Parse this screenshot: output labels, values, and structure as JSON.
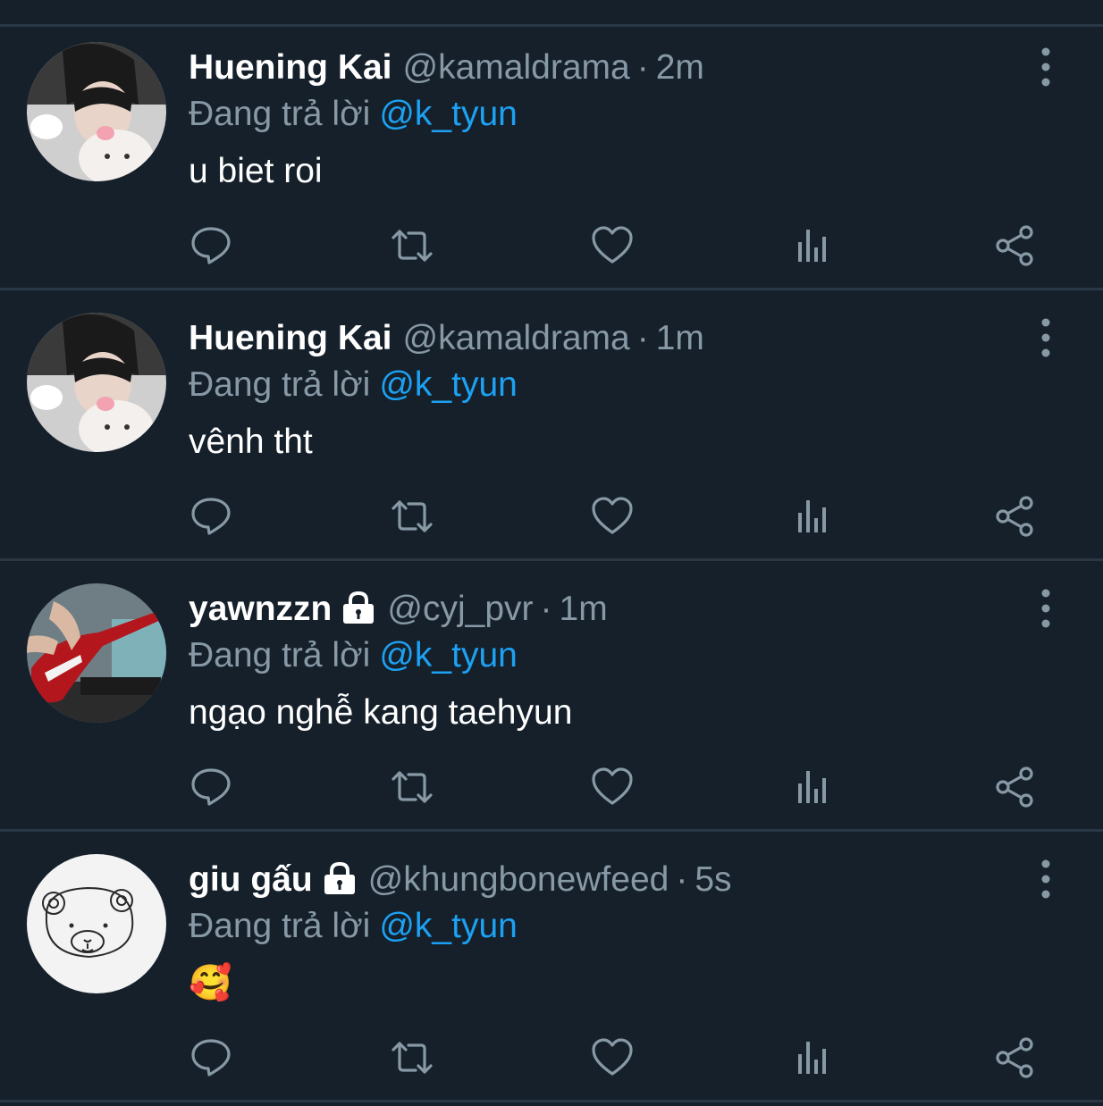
{
  "colors": {
    "background": "#15202b",
    "divider": "#2a3744",
    "secondary_text": "#8899a6",
    "accent": "#1da1f2"
  },
  "tweets": [
    {
      "name": "Huening Kai",
      "locked": false,
      "handle": "@kamaldrama",
      "time": "2m",
      "reply_label": "Đang trả lời",
      "reply_to": "@k_tyun",
      "text": "u biet roi",
      "avatar": "avatar-photo-person-with-plush"
    },
    {
      "name": "Huening Kai",
      "locked": false,
      "handle": "@kamaldrama",
      "time": "1m",
      "reply_label": "Đang trả lời",
      "reply_to": "@k_tyun",
      "text": "vênh tht",
      "avatar": "avatar-photo-person-with-plush"
    },
    {
      "name": "yawnzzn",
      "locked": true,
      "handle": "@cyj_pvr",
      "time": "1m",
      "reply_label": "Đang trả lời",
      "reply_to": "@k_tyun",
      "text": "ngạo nghễ kang taehyun",
      "avatar": "avatar-photo-bass-guitar"
    },
    {
      "name": "giu gấu",
      "locked": true,
      "handle": "@khungbonewfeed",
      "time": "5s",
      "reply_label": "Đang trả lời",
      "reply_to": "@k_tyun",
      "text": "🥰",
      "avatar": "avatar-drawing-bear"
    }
  ],
  "icons": {
    "reply": "reply-icon",
    "retweet": "retweet-icon",
    "like": "heart-icon",
    "analytics": "analytics-icon",
    "share": "share-icon",
    "more": "more-vertical-icon",
    "lock": "lock-icon"
  }
}
